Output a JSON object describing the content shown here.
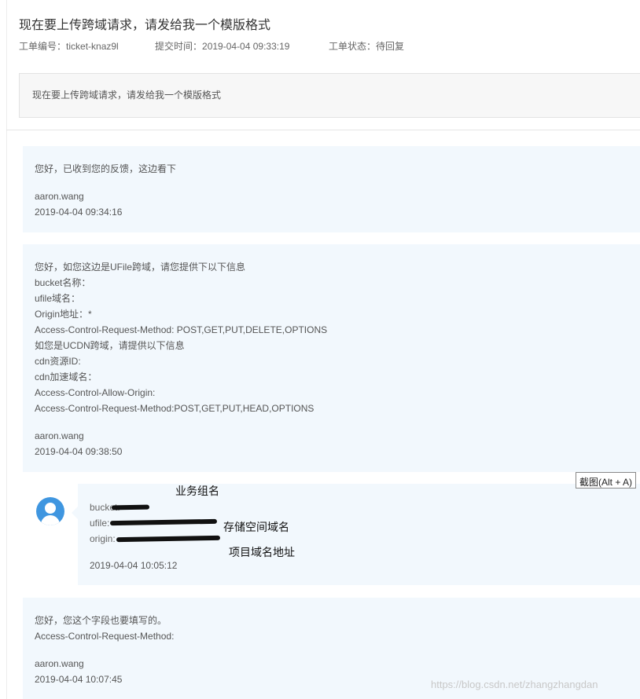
{
  "ticket": {
    "title": "现在要上传跨域请求，请发给我一个模版格式",
    "number_label": "工单编号：",
    "number_value": "ticket-knaz9l",
    "time_label": "提交时间：",
    "time_value": "2019-04-04 09:33:19",
    "status_label": "工单状态：",
    "status_value": "待回复",
    "description": "现在要上传跨域请求，请发给我一个模版格式"
  },
  "messages": [
    {
      "lines": [
        "您好，已收到您的反馈，这边看下"
      ],
      "author": "aaron.wang",
      "time": "2019-04-04 09:34:16"
    },
    {
      "lines": [
        "您好，如您这边是UFile跨域，请您提供下以下信息",
        "bucket名称：",
        "ufile域名：",
        "Origin地址：*",
        "Access-Control-Request-Method: POST,GET,PUT,DELETE,OPTIONS",
        "如您是UCDN跨域，请提供以下信息",
        "cdn资源ID:",
        "cdn加速域名：",
        "Access-Control-Allow-Origin:",
        "Access-Control-Request-Method:POST,GET,PUT,HEAD,OPTIONS"
      ],
      "author": "aaron.wang",
      "time": "2019-04-04 09:38:50"
    },
    {
      "lines": [
        "bucket:",
        "ufile:",
        "origin:"
      ],
      "time": "2019-04-04 10:05:12"
    },
    {
      "lines": [
        "您好，您这个字段也要填写的。",
        "Access-Control-Request-Method:"
      ],
      "author": "aaron.wang",
      "time": "2019-04-04 10:07:45"
    }
  ],
  "annotations": {
    "business_group": "业务组名",
    "storage_domain": "存储空间域名",
    "project_domain": "项目域名地址"
  },
  "tooltip": "截图(Alt + A)",
  "watermark": "https://blog.csdn.net/zhangzhangdan",
  "colors": {
    "bubble_bg": "#f2f8fd",
    "avatar": "#3f96e0",
    "description_bg": "#f7f7f7"
  }
}
